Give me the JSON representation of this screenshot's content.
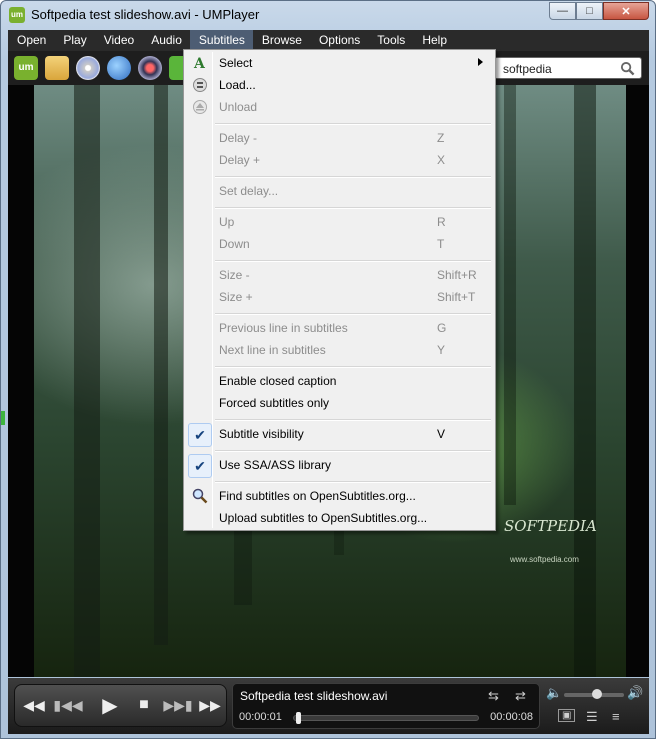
{
  "window": {
    "title": "Softpedia test slideshow.avi - UMPlayer",
    "logo_text": "um"
  },
  "menubar": {
    "items": [
      "Open",
      "Play",
      "Video",
      "Audio",
      "Subtitles",
      "Browse",
      "Options",
      "Tools",
      "Help"
    ],
    "active": "Subtitles"
  },
  "toolbar": {
    "icons": [
      "umplayer-logo-icon",
      "folder-icon",
      "dvd-icon",
      "globe-icon",
      "radio-icon",
      "info-icon"
    ],
    "search_value": "softpedia"
  },
  "video": {
    "watermark": "SOFTPEDIA",
    "watermark_url": "www.softpedia.com"
  },
  "subtitles_menu": {
    "select": "Select",
    "load": "Load...",
    "unload": "Unload",
    "delay_minus": "Delay -",
    "delay_minus_key": "Z",
    "delay_plus": "Delay +",
    "delay_plus_key": "X",
    "set_delay": "Set delay...",
    "up": "Up",
    "up_key": "R",
    "down": "Down",
    "down_key": "T",
    "size_minus": "Size -",
    "size_minus_key": "Shift+R",
    "size_plus": "Size +",
    "size_plus_key": "Shift+T",
    "prev_line": "Previous line in subtitles",
    "prev_line_key": "G",
    "next_line": "Next line in subtitles",
    "next_line_key": "Y",
    "closed_caption": "Enable closed caption",
    "forced_only": "Forced subtitles only",
    "visibility": "Subtitle visibility",
    "visibility_key": "V",
    "visibility_checked": true,
    "ssa": "Use SSA/ASS library",
    "ssa_checked": true,
    "find": "Find subtitles on OpenSubtitles.org...",
    "upload": "Upload subtitles to OpenSubtitles.org..."
  },
  "playback": {
    "file": "Softpedia test slideshow.avi",
    "elapsed": "00:00:01",
    "total": "00:00:08",
    "progress": 0.02,
    "volume": 0.55
  },
  "colors": {
    "menubar": "#2a2a2a",
    "menu_active": "#4d5d73",
    "checked": "#17447f"
  }
}
